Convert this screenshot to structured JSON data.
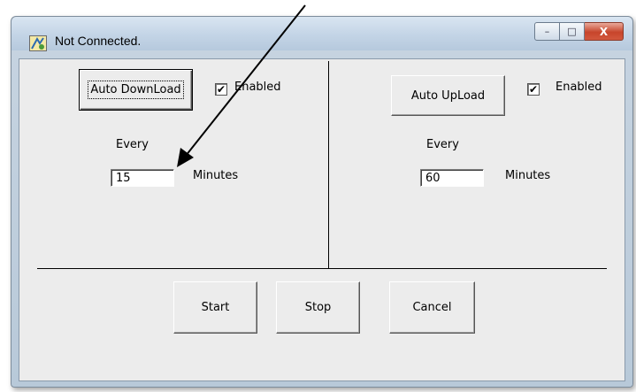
{
  "window": {
    "title": "Not Connected.",
    "icon": "app-icon",
    "minimize_glyph": "–",
    "maximize_glyph": "□",
    "close_glyph": "X"
  },
  "download": {
    "button_label": "Auto DownLoad",
    "enabled_label": "Enabled",
    "enabled_checked": true,
    "every_label": "Every",
    "minutes_value": "15",
    "minutes_label": "Minutes"
  },
  "upload": {
    "button_label": "Auto UpLoad",
    "enabled_label": "Enabled",
    "enabled_checked": true,
    "every_label": "Every",
    "minutes_value": "60",
    "minutes_label": "Minutes"
  },
  "actions": {
    "start_label": "Start",
    "stop_label": "Stop",
    "cancel_label": "Cancel"
  },
  "check_glyph": "✔",
  "colors": {
    "close_button": "#c7452b",
    "annotation_arrow": "#000000"
  }
}
